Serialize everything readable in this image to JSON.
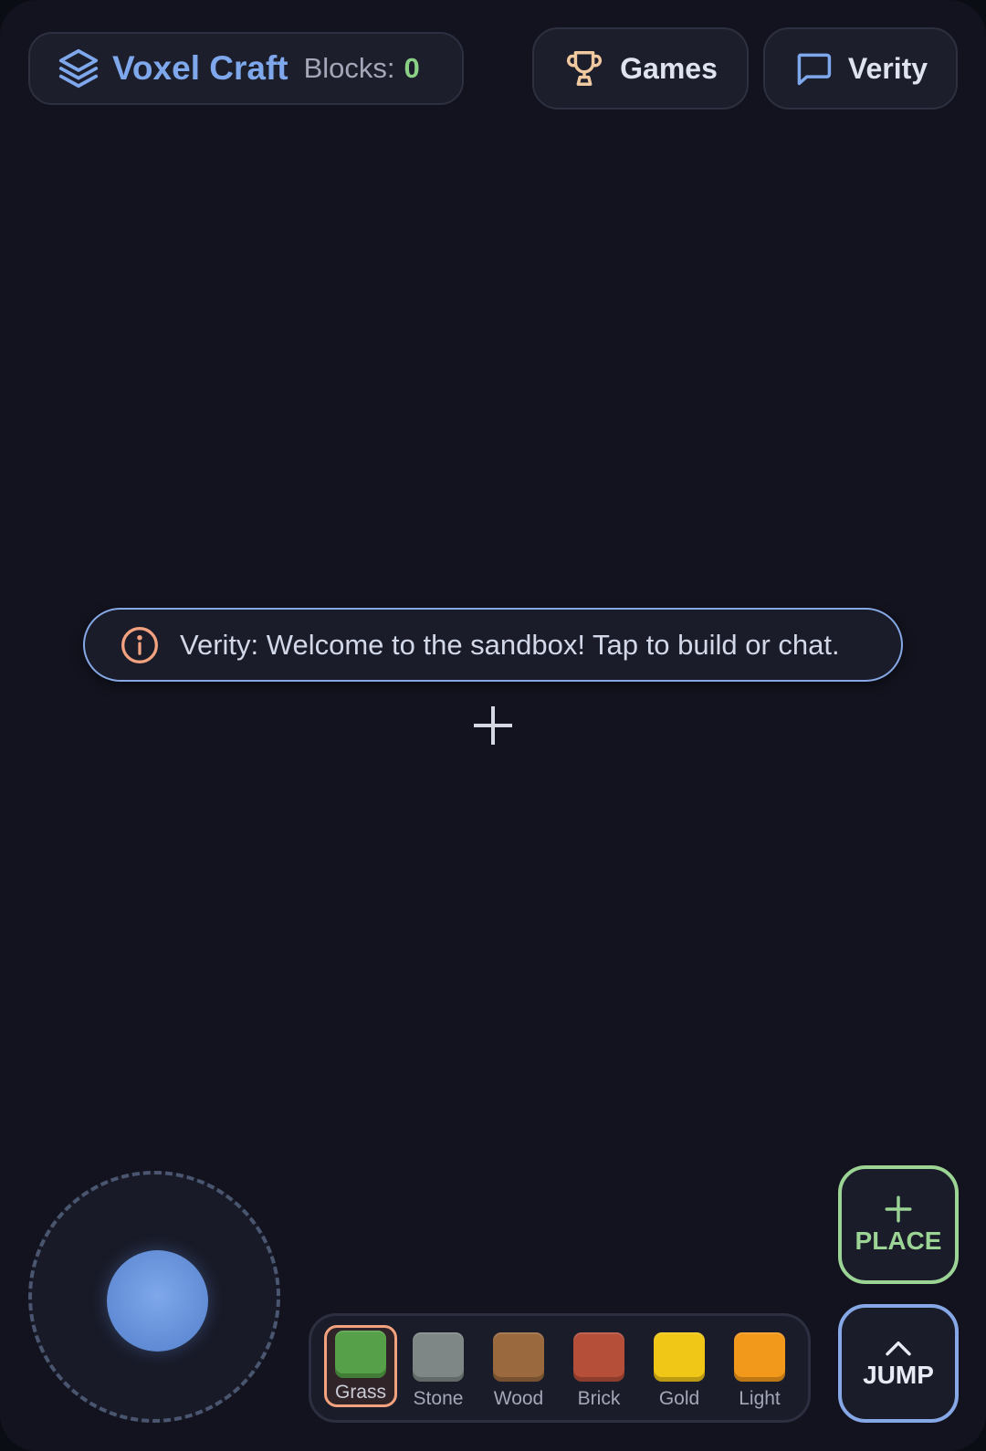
{
  "header": {
    "title": "Voxel Craft",
    "blocks_label": "Blocks:",
    "blocks_count": "0"
  },
  "nav": {
    "games_label": "Games",
    "verity_label": "Verity"
  },
  "notification": {
    "text": "Verity: Welcome to the sandbox! Tap to build or chat."
  },
  "hotbar": {
    "selected": "Grass",
    "slots": [
      {
        "label": "Grass",
        "color": "#55a048"
      },
      {
        "label": "Stone",
        "color": "#7e8785"
      },
      {
        "label": "Wood",
        "color": "#9a6a3e"
      },
      {
        "label": "Brick",
        "color": "#b64f3a"
      },
      {
        "label": "Gold",
        "color": "#f0c617"
      },
      {
        "label": "Light",
        "color": "#f2991c"
      }
    ]
  },
  "actions": {
    "place_label": "PLACE",
    "jump_label": "JUMP"
  },
  "colors": {
    "accent_blue": "#7fa8ec",
    "accent_green": "#9bd494",
    "accent_orange": "#f2a27f",
    "background": "#12131e"
  },
  "icons": {
    "title": "layers-icon",
    "games": "trophy-icon",
    "verity": "chat-bubble-icon",
    "notification": "info-icon",
    "place": "plus-icon",
    "jump": "chevron-up-icon"
  }
}
